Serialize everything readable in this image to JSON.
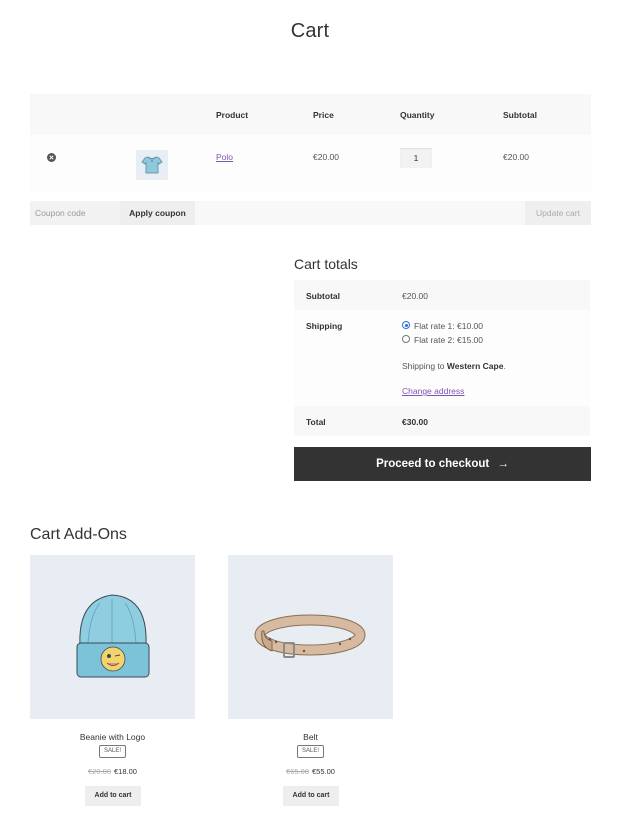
{
  "page": {
    "title": "Cart"
  },
  "cart": {
    "headers": {
      "product": "Product",
      "price": "Price",
      "quantity": "Quantity",
      "subtotal": "Subtotal"
    },
    "items": [
      {
        "name": "Polo",
        "price": "€20.00",
        "quantity": "1",
        "subtotal": "€20.00",
        "thumb_icon": "polo-shirt-icon"
      }
    ],
    "coupon_placeholder": "Coupon code",
    "apply_coupon_label": "Apply coupon",
    "update_cart_label": "Update cart"
  },
  "totals": {
    "title": "Cart totals",
    "subtotal_label": "Subtotal",
    "subtotal_value": "€20.00",
    "shipping_label": "Shipping",
    "shipping_options": [
      {
        "label": "Flat rate 1: €10.00",
        "selected": true
      },
      {
        "label": "Flat rate 2: €15.00",
        "selected": false
      }
    ],
    "shipping_to_prefix": "Shipping to ",
    "shipping_to_region": "Western Cape",
    "shipping_to_suffix": ".",
    "change_address_label": "Change address",
    "total_label": "Total",
    "total_value": "€30.00",
    "checkout_label": "Proceed to checkout",
    "checkout_arrow": "→"
  },
  "addons": {
    "title": "Cart Add-Ons",
    "products": [
      {
        "name": "Beanie with Logo",
        "badge": "Sale!",
        "old_price": "€20.00",
        "price": "€18.00",
        "button": "Add to cart",
        "image_icon": "beanie-icon"
      },
      {
        "name": "Belt",
        "badge": "Sale!",
        "old_price": "€65.00",
        "price": "€55.00",
        "button": "Add to cart",
        "image_icon": "belt-icon"
      }
    ]
  },
  "colors": {
    "link": "#7f54b3",
    "checkout_bg": "#333333",
    "row_bg": "#f8f8f8",
    "product_bg": "#e7edf2"
  }
}
